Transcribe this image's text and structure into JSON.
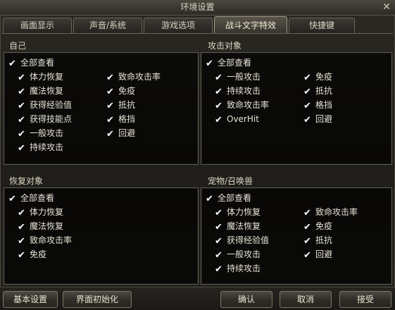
{
  "window": {
    "title": "环境设置",
    "close": "✕"
  },
  "tabs": [
    {
      "label": "画面显示"
    },
    {
      "label": "声音/系统"
    },
    {
      "label": "游戏选项"
    },
    {
      "label": "战斗文字特效"
    },
    {
      "label": "快捷键"
    }
  ],
  "active_tab": "战斗文字特效",
  "check_glyph": "✔",
  "sections": {
    "self": {
      "title": "自己",
      "view_all": "全部查看",
      "col1": [
        "体力恢复",
        "魔法恢复",
        "获得经验值",
        "获得技能点",
        "一般攻击",
        "持续攻击"
      ],
      "col2": [
        "致命攻击率",
        "免疫",
        "抵抗",
        "格挡",
        "回避"
      ]
    },
    "attack_target": {
      "title": "攻击对象",
      "view_all": "全部查看",
      "col1": [
        "一般攻击",
        "持续攻击",
        "致命攻击率",
        "OverHit"
      ],
      "col2": [
        "免疫",
        "抵抗",
        "格挡",
        "回避"
      ]
    },
    "recover_target": {
      "title": "恢复对象",
      "view_all": "全部查看",
      "col1": [
        "体力恢复",
        "魔法恢复",
        "致命攻击率",
        "免疫"
      ]
    },
    "pet": {
      "title": "宠物/召唤兽",
      "view_all": "全部查看",
      "col1": [
        "体力恢复",
        "魔法恢复",
        "获得经验值",
        "一般攻击",
        "持续攻击"
      ],
      "col2": [
        "致命攻击率",
        "免疫",
        "抵抗",
        "回避"
      ]
    }
  },
  "buttons": {
    "basic": "基本设置",
    "reset_ui": "界面初始化",
    "confirm": "确认",
    "cancel": "取消",
    "accept": "接受"
  }
}
